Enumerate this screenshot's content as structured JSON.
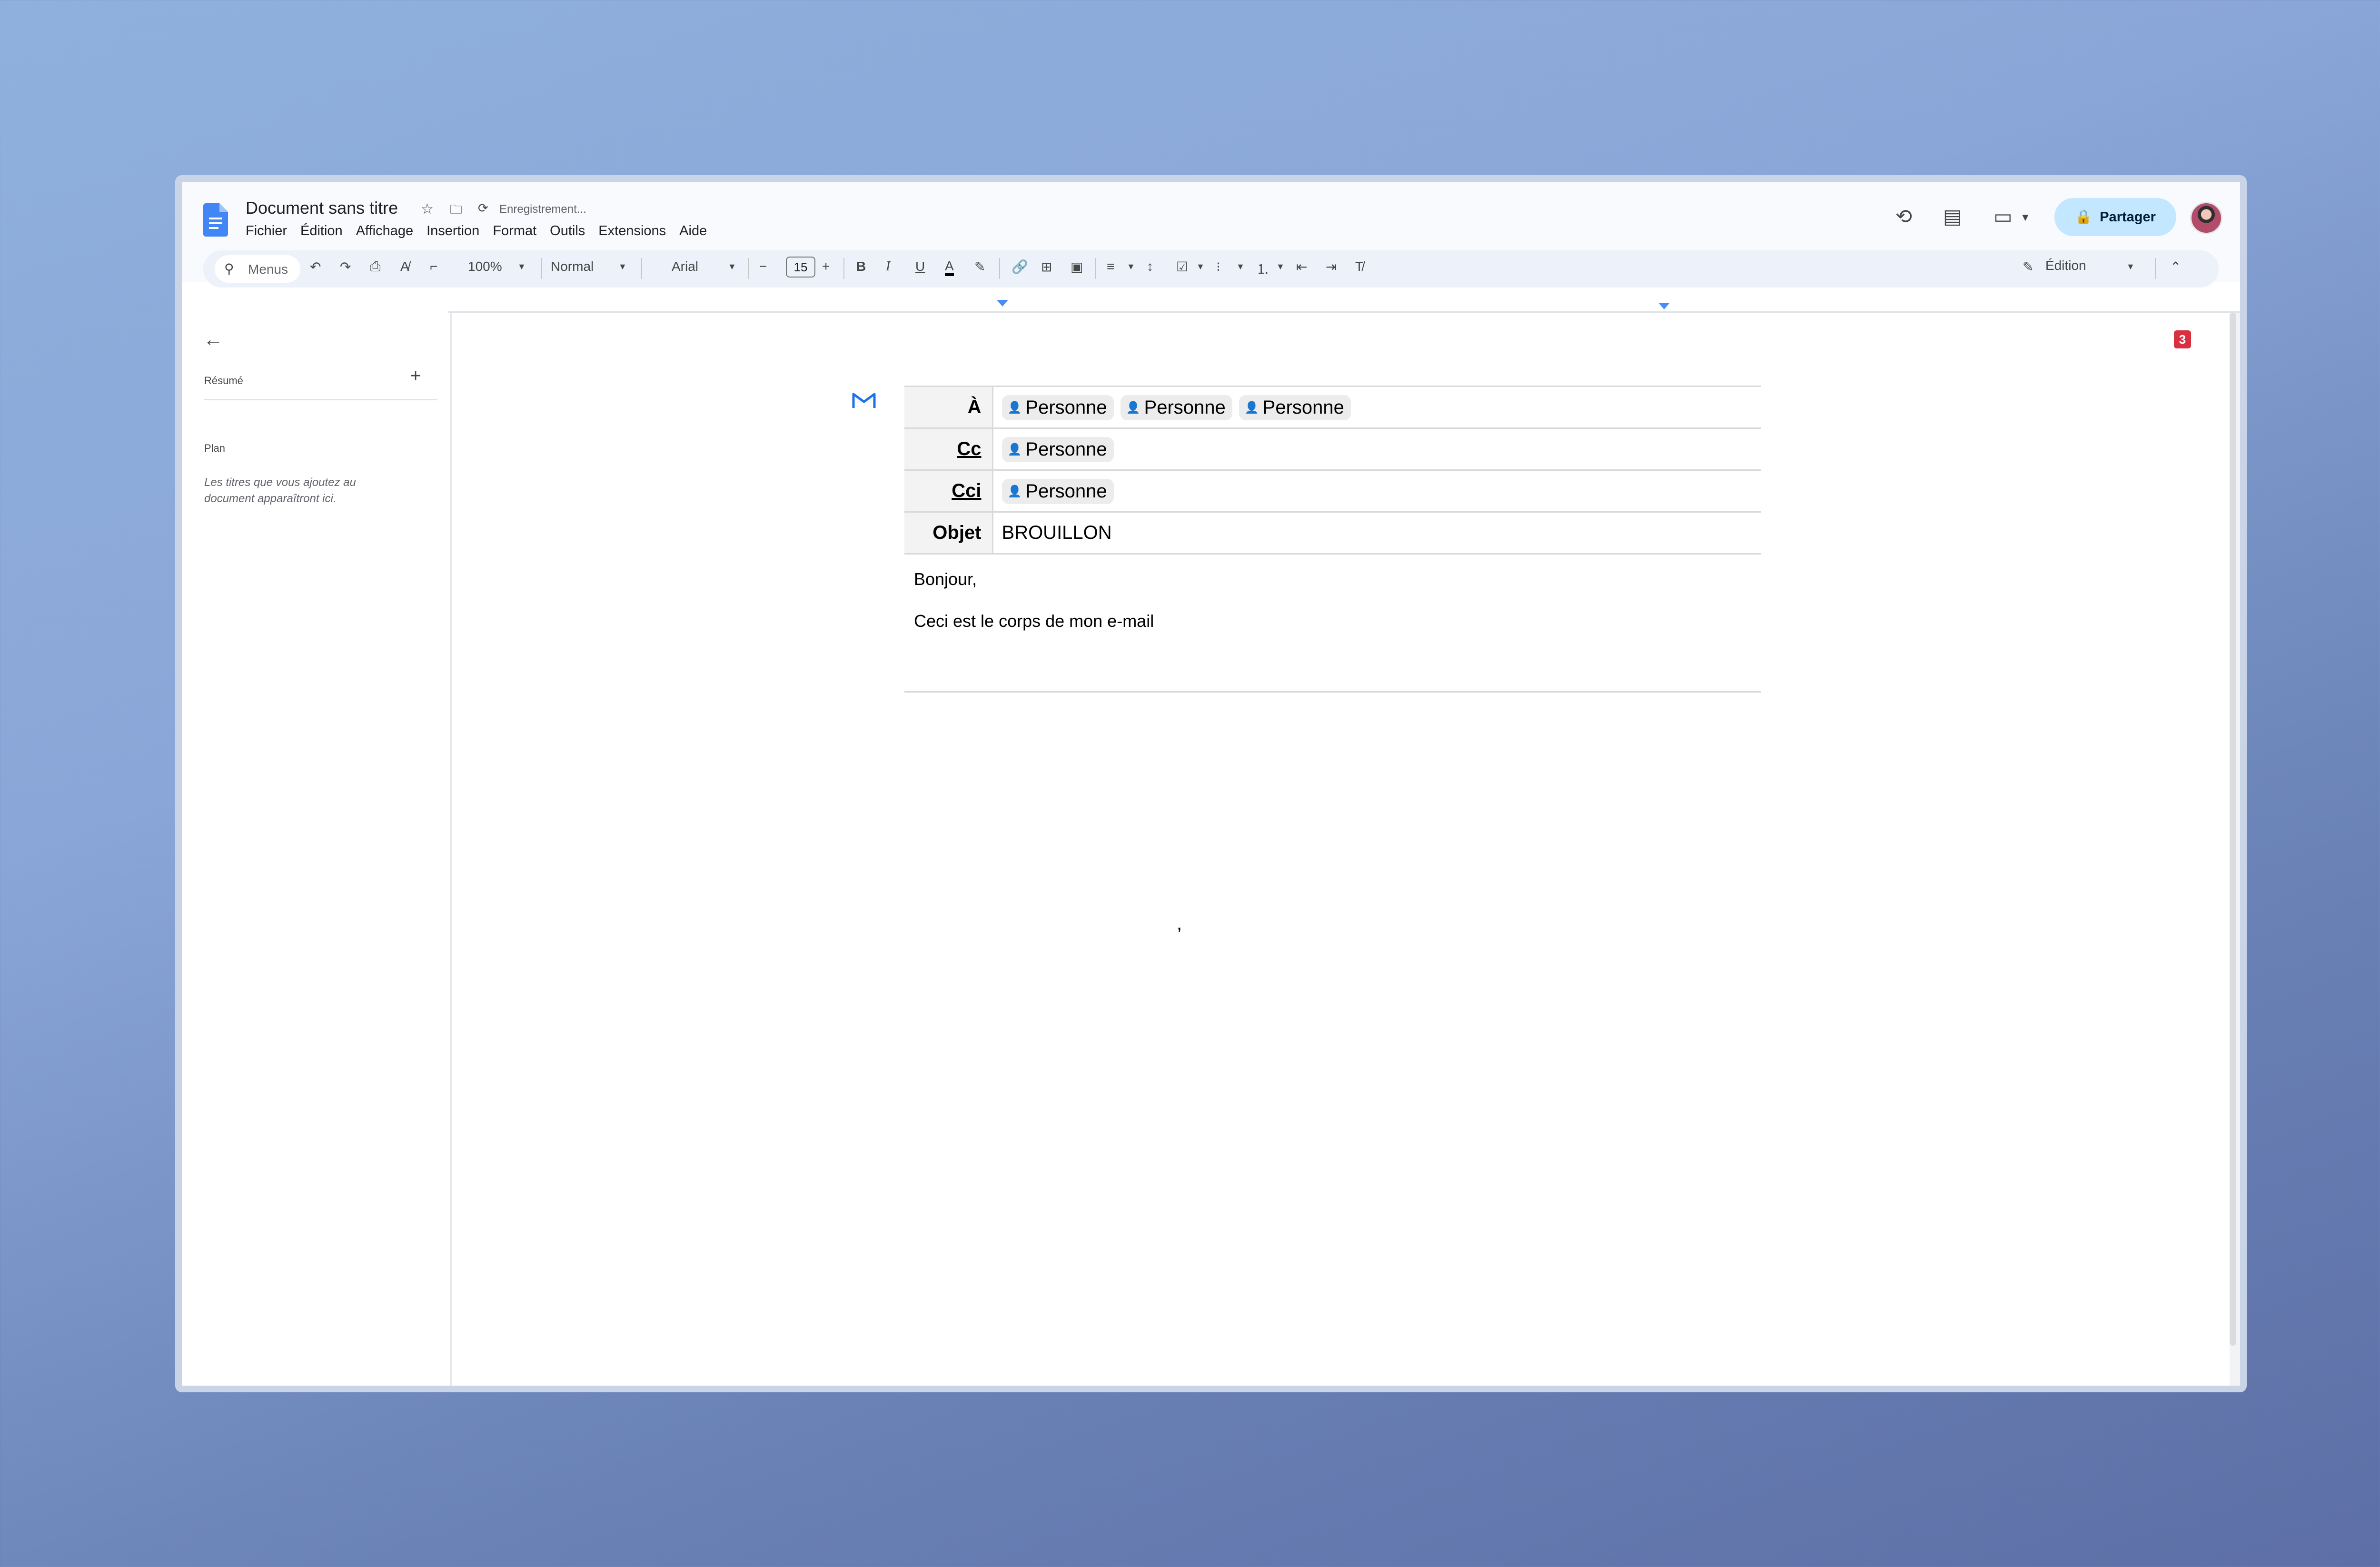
{
  "doc": {
    "title": "Document sans titre",
    "saving_status": "Enregistrement..."
  },
  "menu": [
    "Fichier",
    "Édition",
    "Affichage",
    "Insertion",
    "Format",
    "Outils",
    "Extensions",
    "Aide"
  ],
  "header_right": {
    "share_label": "Partager"
  },
  "toolbar": {
    "search_placeholder": "Menus",
    "zoom": "100%",
    "style": "Normal",
    "font": "Arial",
    "font_size": "15",
    "mode": "Édition"
  },
  "sidebar": {
    "summary_label": "Résumé",
    "outline_label": "Plan",
    "outline_hint": "Les titres que vous ajoutez au document apparaîtront ici."
  },
  "comment_count": "3",
  "email": {
    "to_label": "À",
    "cc_label": "Cc",
    "bcc_label": "Cci",
    "subject_label": "Objet",
    "to_chips": [
      "Personne",
      "Personne",
      "Personne"
    ],
    "cc_chips": [
      "Personne"
    ],
    "bcc_chips": [
      "Personne"
    ],
    "subject": "BROUILLON",
    "body_greeting": "Bonjour,",
    "body_text": "Ceci est le corps de mon e-mail"
  },
  "icons": {
    "accent": "#1a73e8",
    "share_bg": "#c2e7ff",
    "badge_color": "#d93041"
  }
}
